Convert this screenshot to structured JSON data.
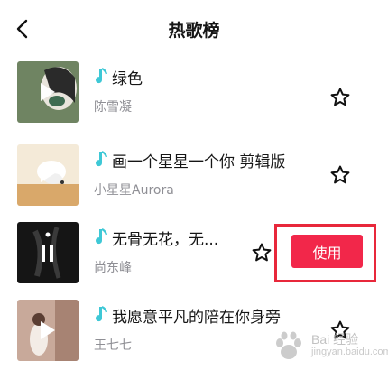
{
  "header": {
    "title": "热歌榜"
  },
  "songs": [
    {
      "name": "绿色",
      "artist": "陈雪凝",
      "favorited": false
    },
    {
      "name": "画一个星星一个你 剪辑版",
      "artist": "小星星Aurora",
      "favorited": false
    },
    {
      "name": "无骨无花，无...",
      "artist": "尚东峰",
      "favorited": false,
      "action_label": "使用"
    },
    {
      "name": "我愿意平凡的陪在你身旁",
      "artist": "王七七",
      "favorited": false
    }
  ],
  "colors": {
    "accent": "#f2274a",
    "highlight_frame": "#e8283b",
    "note_icon": "#3ec8d6",
    "artist_text": "#8f8f95"
  },
  "watermark": {
    "text": "Bai 经验",
    "sub": "jingyan.baidu.com"
  }
}
